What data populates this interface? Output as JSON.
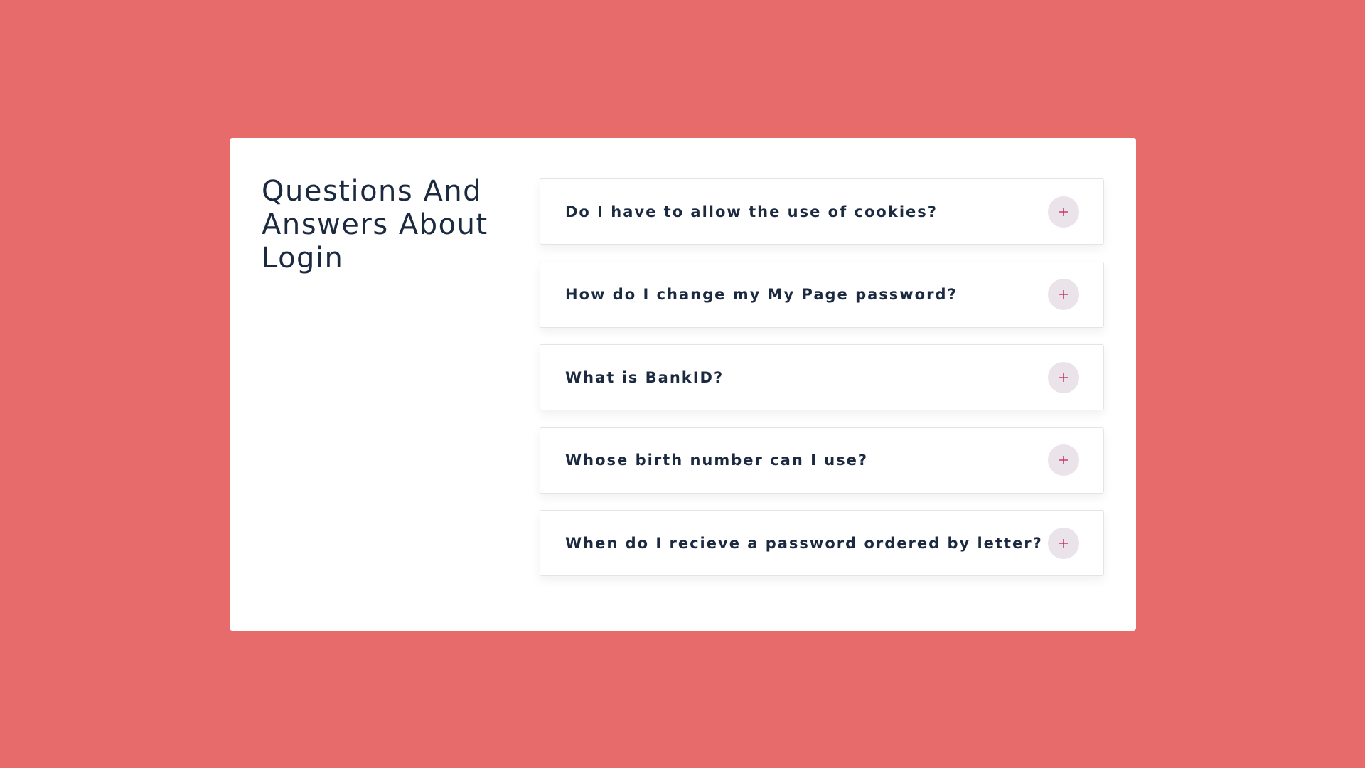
{
  "page": {
    "title": "Questions And Answers About Login"
  },
  "faq": {
    "items": [
      {
        "question": "Do I have to allow the use of cookies?",
        "icon": "plus-icon"
      },
      {
        "question": "How do I change my My Page password?",
        "icon": "plus-icon"
      },
      {
        "question": "What is BankID?",
        "icon": "plus-icon"
      },
      {
        "question": "Whose birth number can I use?",
        "icon": "plus-icon"
      },
      {
        "question": "When do I recieve a password ordered by letter?",
        "icon": "plus-icon"
      }
    ]
  },
  "colors": {
    "background": "#e76b6b",
    "card": "#ffffff",
    "text": "#1b2a40",
    "toggle_bg": "#ebe3ea",
    "toggle_icon": "#c2185b"
  }
}
